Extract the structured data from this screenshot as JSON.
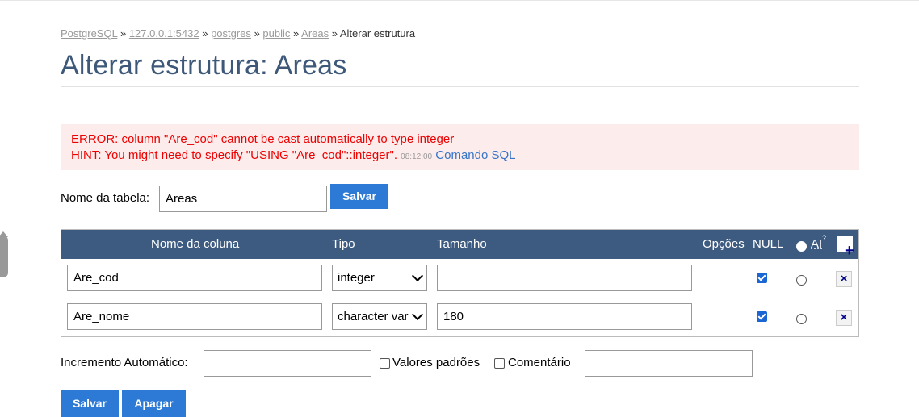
{
  "breadcrumb": {
    "items": [
      "PostgreSQL",
      "127.0.0.1:5432",
      "postgres",
      "public",
      "Areas"
    ],
    "separator": "»",
    "current": "Alterar estrutura"
  },
  "page_title": "Alterar estrutura: Areas",
  "error": {
    "line1": "ERROR: column \"Are_cod\" cannot be cast automatically to type integer",
    "line2": "HINT: You might need to specify \"USING \"Are_cod\"::integer\".",
    "time": "08:12:00",
    "link": "Comando SQL"
  },
  "table_name": {
    "label": "Nome da tabela:",
    "value": "Areas",
    "save_label": "Salvar"
  },
  "columns_table": {
    "headers": {
      "name": "Nome da coluna",
      "type": "Tipo",
      "size": "Tamanho",
      "options": "Opções",
      "null": "NULL",
      "ai": "AI",
      "ai_sup": "?",
      "add_icon": "plus-icon"
    },
    "rows": [
      {
        "name": "Are_cod",
        "type": "integer",
        "size": "",
        "null_checked": true,
        "ai_selected": false,
        "remove_icon": "close-icon"
      },
      {
        "name": "Are_nome",
        "type": "character var",
        "size": "180",
        "null_checked": true,
        "ai_selected": false,
        "remove_icon": "close-icon"
      }
    ]
  },
  "footer": {
    "auto_increment_label": "Incremento Automático:",
    "auto_increment_value": "",
    "defaults_label": "Valores padrões",
    "comment_label": "Comentário",
    "comment_value": "",
    "save_label": "Salvar",
    "delete_label": "Apagar"
  },
  "colors": {
    "header_bg": "#3d5a80",
    "button_bg": "#2d7ad6",
    "error_bg": "#fdecec",
    "error_text": "#e00000",
    "title": "#3d5878",
    "link": "#3674c8"
  }
}
